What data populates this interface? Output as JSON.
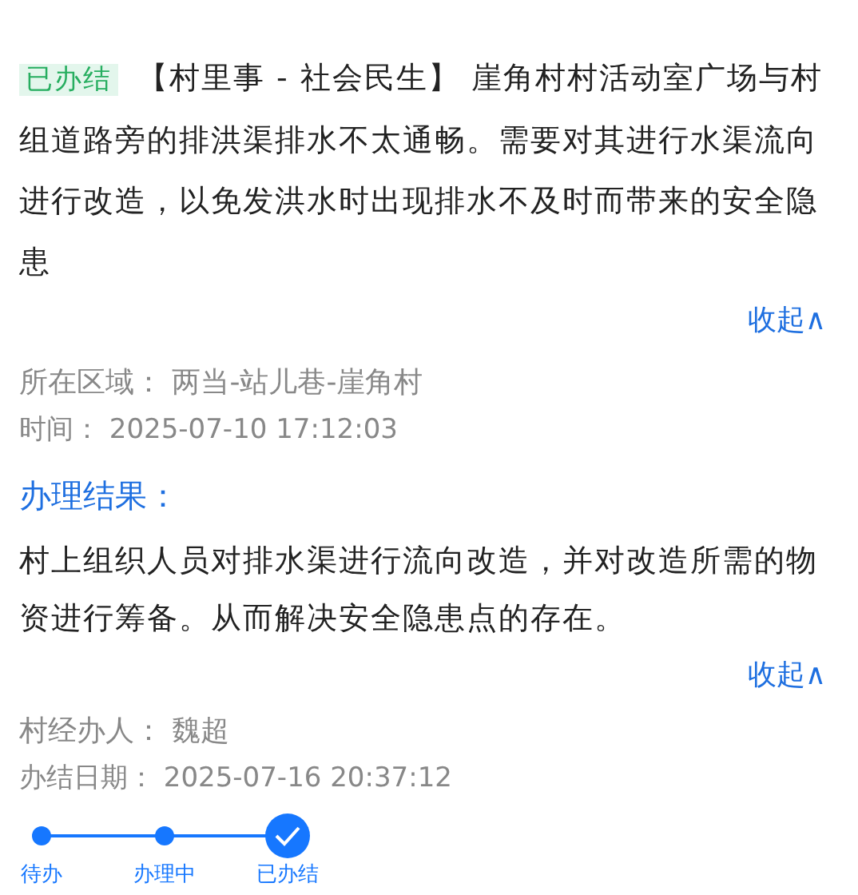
{
  "issue": {
    "status_badge": "已办结",
    "text": "【村里事 - 社会民生】 崖角村村活动室广场与村组道路旁的排洪渠排水不太通畅。需要对其进行水渠流向进行改造，以免发洪水时出现排水不及时而带来的安全隐患",
    "collapse_link": "收起∧",
    "area": "所在区域： 两当-站儿巷-崖角村",
    "time": "时间： 2025-07-10  17:12:03"
  },
  "result": {
    "heading": "办理结果：",
    "text": "村上组织人员对排水渠进行流向改造，并对改造所需的物资进行筹备。从而解决安全隐患点的存在。",
    "collapse_link": "收起∧",
    "handler": "村经办人： 魏超",
    "done_date": "办结日期： 2025-07-16  20:37:12"
  },
  "steps": [
    {
      "label": "待办",
      "kind": "dot"
    },
    {
      "label": "办理中",
      "kind": "dot"
    },
    {
      "label": "已办结",
      "kind": "check"
    }
  ]
}
